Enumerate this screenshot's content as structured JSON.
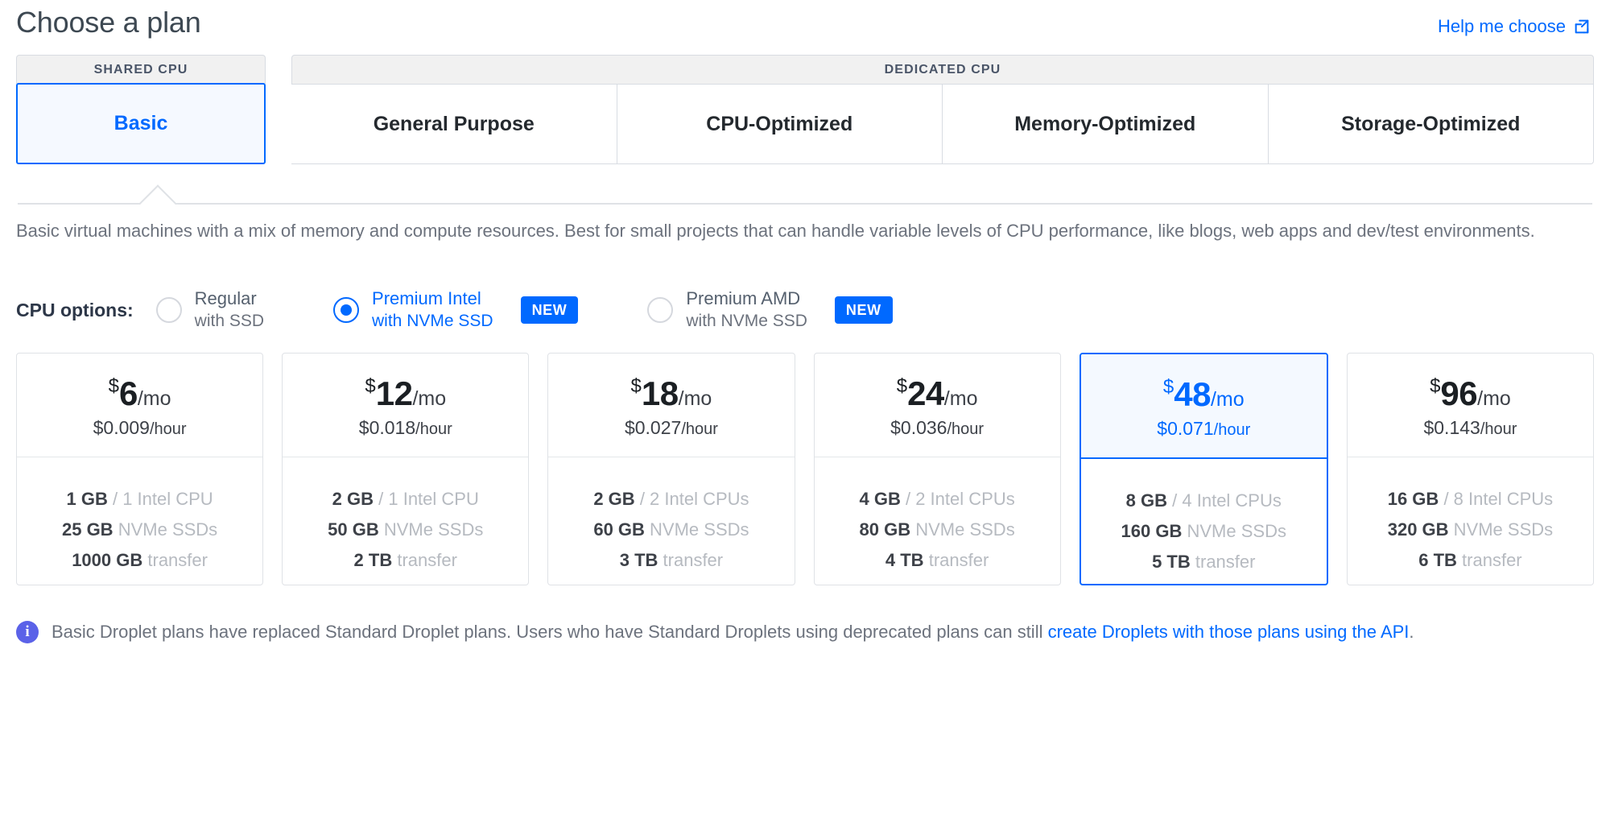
{
  "header": {
    "title": "Choose a plan",
    "help_link_label": "Help me choose",
    "help_link_icon": "external-link-icon"
  },
  "plan_tabs": {
    "shared_cpu_caption": "SHARED CPU",
    "dedicated_cpu_caption": "DEDICATED CPU",
    "shared_tabs": [
      {
        "label": "Basic",
        "selected": true
      }
    ],
    "dedicated_tabs": [
      {
        "label": "General Purpose",
        "selected": false
      },
      {
        "label": "CPU-Optimized",
        "selected": false
      },
      {
        "label": "Memory-Optimized",
        "selected": false
      },
      {
        "label": "Storage-Optimized",
        "selected": false
      }
    ]
  },
  "description": "Basic virtual machines with a mix of memory and compute resources. Best for small projects that can handle variable levels of CPU performance, like blogs, web apps and dev/test environments.",
  "cpu_options": {
    "label": "CPU options:",
    "options": [
      {
        "main": "Regular",
        "sub": "with SSD",
        "selected": false,
        "badge": ""
      },
      {
        "main": "Premium Intel",
        "sub": "with NVMe SSD",
        "selected": true,
        "badge": "NEW"
      },
      {
        "main": "Premium AMD",
        "sub": "with NVMe SSD",
        "selected": false,
        "badge": "NEW"
      }
    ]
  },
  "plans": [
    {
      "currency": "$",
      "monthly": "6",
      "per": "/mo",
      "hourly": "$0.009",
      "hourly_unit": "/hour",
      "memory": "1 GB",
      "cpu": "/ 1 Intel CPU",
      "disk": "25 GB",
      "disk_label": "NVMe SSDs",
      "transfer": "1000 GB",
      "transfer_label": "transfer",
      "selected": false
    },
    {
      "currency": "$",
      "monthly": "12",
      "per": "/mo",
      "hourly": "$0.018",
      "hourly_unit": "/hour",
      "memory": "2 GB",
      "cpu": "/ 1 Intel CPU",
      "disk": "50 GB",
      "disk_label": "NVMe SSDs",
      "transfer": "2 TB",
      "transfer_label": "transfer",
      "selected": false
    },
    {
      "currency": "$",
      "monthly": "18",
      "per": "/mo",
      "hourly": "$0.027",
      "hourly_unit": "/hour",
      "memory": "2 GB",
      "cpu": "/ 2 Intel CPUs",
      "disk": "60 GB",
      "disk_label": "NVMe SSDs",
      "transfer": "3 TB",
      "transfer_label": "transfer",
      "selected": false
    },
    {
      "currency": "$",
      "monthly": "24",
      "per": "/mo",
      "hourly": "$0.036",
      "hourly_unit": "/hour",
      "memory": "4 GB",
      "cpu": "/ 2 Intel CPUs",
      "disk": "80 GB",
      "disk_label": "NVMe SSDs",
      "transfer": "4 TB",
      "transfer_label": "transfer",
      "selected": false
    },
    {
      "currency": "$",
      "monthly": "48",
      "per": "/mo",
      "hourly": "$0.071",
      "hourly_unit": "/hour",
      "memory": "8 GB",
      "cpu": "/ 4 Intel CPUs",
      "disk": "160 GB",
      "disk_label": "NVMe SSDs",
      "transfer": "5 TB",
      "transfer_label": "transfer",
      "selected": true
    },
    {
      "currency": "$",
      "monthly": "96",
      "per": "/mo",
      "hourly": "$0.143",
      "hourly_unit": "/hour",
      "memory": "16 GB",
      "cpu": "/ 8 Intel CPUs",
      "disk": "320 GB",
      "disk_label": "NVMe SSDs",
      "transfer": "6 TB",
      "transfer_label": "transfer",
      "selected": false
    }
  ],
  "notice": {
    "icon": "info-icon",
    "text_before": "Basic Droplet plans have replaced Standard Droplet plans. Users who have Standard Droplets using deprecated plans can still ",
    "link_text": "create Droplets with those plans using the API",
    "text_after": "."
  },
  "colors": {
    "accent": "#0069ff",
    "accent_bg": "#f4f9ff",
    "text": "#3d4148",
    "muted": "#6c727d",
    "spec_label": "#b6bac0",
    "border": "#dfe2e6",
    "info": "#5b62e8"
  }
}
